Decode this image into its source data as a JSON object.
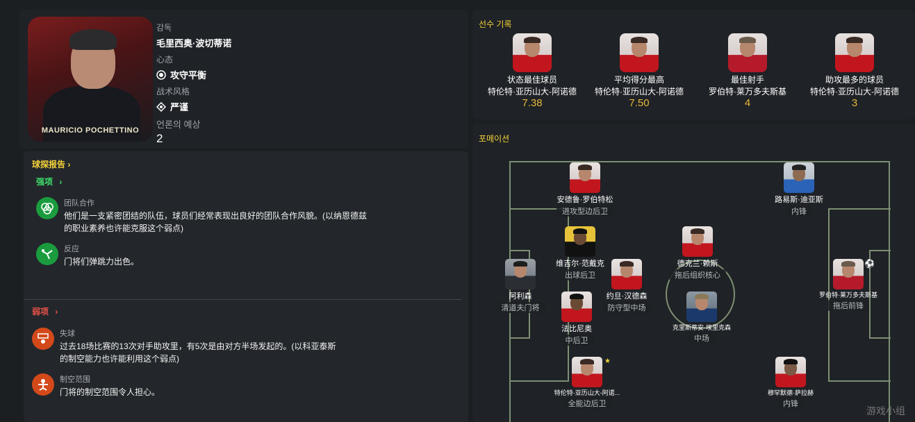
{
  "manager": {
    "photo_caption": "MAURICIO POCHETTINO",
    "role_label": "감독",
    "name": "毛里西奥·波切蒂诺",
    "mentality_label": "心态",
    "mentality": "攻守平衡",
    "style_label": "战术风格",
    "style": "严谨",
    "prediction_label": "언론의 예상",
    "prediction": "2"
  },
  "report": {
    "title": "球探报告",
    "strengths_label": "强项",
    "strengths": [
      {
        "icon": "teamwork-icon",
        "title": "团队合作",
        "desc1": "他们是一支紧密团结的队伍，球员们经常表现出良好的团队合作风貌。(以纳恩德兹",
        "desc2": "的职业素养也许能克服这个弱点)"
      },
      {
        "icon": "reflex-icon",
        "title": "反应",
        "desc1": "门将们弹跳力出色。",
        "desc2": ""
      }
    ],
    "weaknesses_label": "弱项",
    "weaknesses": [
      {
        "icon": "goal-conceded-icon",
        "title": "失球",
        "desc1": "过去18场比赛的13次对手助攻里，有5次是由对方半场发起的。(以科亚泰斯",
        "desc2": "的制空能力也许能利用这个弱点)"
      },
      {
        "icon": "aerial-icon",
        "title": "制空范围",
        "desc1": "门将的制空范围令人担心。",
        "desc2": ""
      }
    ]
  },
  "records": {
    "title": "선수 기록",
    "items": [
      {
        "label": "状态最佳球员",
        "player": "特伦特·亚历山大-阿诺德",
        "value": "7.38"
      },
      {
        "label": "平均得分最高",
        "player": "特伦特·亚历山大-阿诺德",
        "value": "7.50"
      },
      {
        "label": "最佳射手",
        "player": "罗伯特·莱万多夫斯基",
        "value": "4"
      },
      {
        "label": "助攻最多的球员",
        "player": "特伦特·亚历山大-阿诺德",
        "value": "3"
      }
    ]
  },
  "formation": {
    "title": "포메이션",
    "players": [
      {
        "name": "安德鲁·罗伯特松",
        "pos": "进攻型边后卫"
      },
      {
        "name": "路易斯·迪亚斯",
        "pos": "内锋"
      },
      {
        "name": "维吉尔·范戴克",
        "pos": "出球后卫"
      },
      {
        "name": "德克兰·赖斯",
        "pos": "拖后组织核心"
      },
      {
        "name": "阿利森",
        "pos": "清道夫门将"
      },
      {
        "name": "约旦·汉德森",
        "pos": "防守型中场"
      },
      {
        "name": "罗伯特·莱万多夫斯基",
        "pos": "拖后前锋"
      },
      {
        "name": "法比尼奥",
        "pos": "中后卫"
      },
      {
        "name": "克里斯蒂安·埃里克森",
        "pos": "中场"
      },
      {
        "name": "特伦特·亚历山大-阿诺...",
        "pos": "全能边后卫"
      },
      {
        "name": "穆罕默德·萨拉赫",
        "pos": "内锋"
      }
    ]
  },
  "watermark": "游戏小组"
}
